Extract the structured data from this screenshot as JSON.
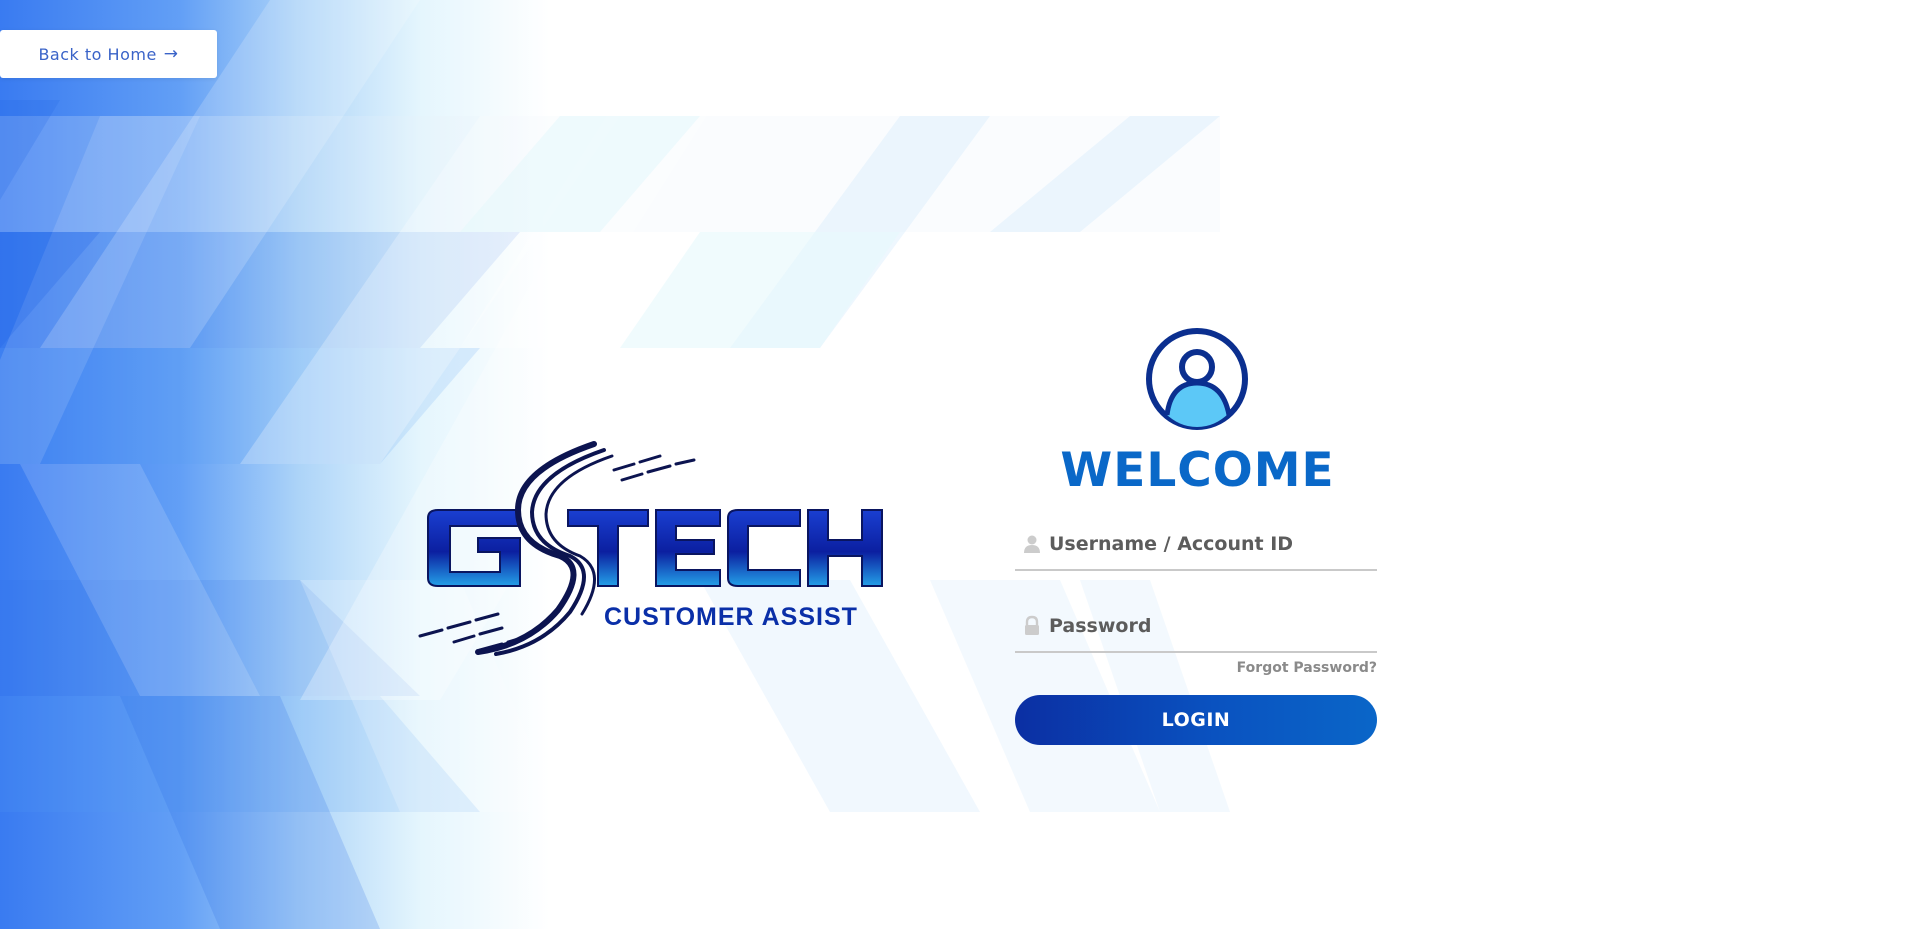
{
  "nav": {
    "back_label": "Back to Home",
    "back_arrow": "→"
  },
  "brand": {
    "logo_text": "GSTECH",
    "subtitle": "CUSTOMER ASSIST",
    "colors": {
      "primary": "#0a2fa8",
      "accent": "#0a68c8"
    }
  },
  "login": {
    "avatar_icon": "user-avatar-icon",
    "welcome": "WELCOME",
    "username": {
      "placeholder": "Username / Account ID",
      "value": "",
      "icon": "user-icon"
    },
    "password": {
      "placeholder": "Password",
      "value": "",
      "icon": "lock-icon"
    },
    "forgot_label": "Forgot Password?",
    "submit_label": "LOGIN"
  },
  "theme": {
    "background_blue": "#3b7cf2",
    "background_light": "#cfe8fb",
    "field_line": "#c9c9c9"
  }
}
